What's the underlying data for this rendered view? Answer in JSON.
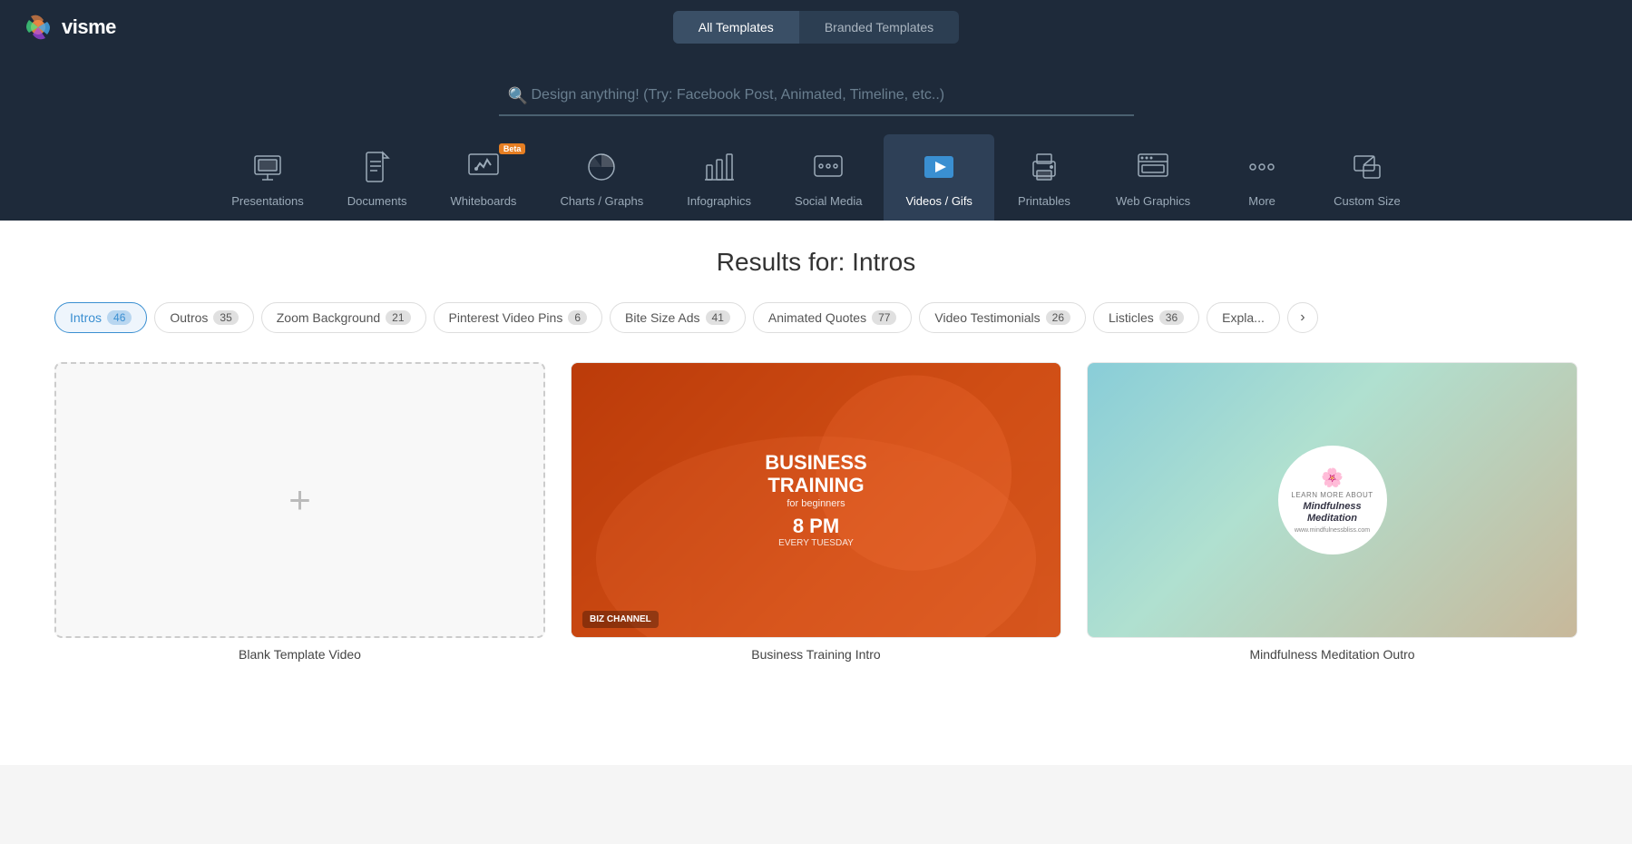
{
  "logo": {
    "text": "visme"
  },
  "header": {
    "toggle": {
      "all_templates": "All Templates",
      "branded_templates": "Branded Templates",
      "active": "all"
    }
  },
  "search": {
    "placeholder": "Design anything! (Try: Facebook Post, Animated, Timeline, etc..)"
  },
  "categories": [
    {
      "id": "presentations",
      "label": "Presentations",
      "icon": "presentation",
      "active": false
    },
    {
      "id": "documents",
      "label": "Documents",
      "icon": "document",
      "active": false
    },
    {
      "id": "whiteboards",
      "label": "Whiteboards",
      "icon": "whiteboard",
      "active": false,
      "beta": true
    },
    {
      "id": "charts-graphs",
      "label": "Charts / Graphs",
      "icon": "chart",
      "active": false
    },
    {
      "id": "infographics",
      "label": "Infographics",
      "icon": "infographic",
      "active": false
    },
    {
      "id": "social-media",
      "label": "Social Media",
      "icon": "social",
      "active": false
    },
    {
      "id": "videos-gifs",
      "label": "Videos / Gifs",
      "icon": "video",
      "active": true
    },
    {
      "id": "printables",
      "label": "Printables",
      "icon": "print",
      "active": false
    },
    {
      "id": "web-graphics",
      "label": "Web Graphics",
      "icon": "web",
      "active": false
    },
    {
      "id": "more",
      "label": "More",
      "icon": "more",
      "active": false
    },
    {
      "id": "custom-size",
      "label": "Custom Size",
      "icon": "custom",
      "active": false
    }
  ],
  "results": {
    "heading": "Results for: Intros"
  },
  "filters": [
    {
      "id": "intros",
      "label": "Intros",
      "count": 46,
      "active": true
    },
    {
      "id": "outros",
      "label": "Outros",
      "count": 35,
      "active": false
    },
    {
      "id": "zoom-background",
      "label": "Zoom Background",
      "count": 21,
      "active": false
    },
    {
      "id": "pinterest-video-pins",
      "label": "Pinterest Video Pins",
      "count": 6,
      "active": false
    },
    {
      "id": "bite-size-ads",
      "label": "Bite Size Ads",
      "count": 41,
      "active": false
    },
    {
      "id": "animated-quotes",
      "label": "Animated Quotes",
      "count": 77,
      "active": false
    },
    {
      "id": "video-testimonials",
      "label": "Video Testimonials",
      "count": 26,
      "active": false
    },
    {
      "id": "listicles",
      "label": "Listicles",
      "count": 36,
      "active": false
    },
    {
      "id": "expla",
      "label": "Expla...",
      "count": null,
      "active": false
    }
  ],
  "templates": [
    {
      "id": "blank",
      "name": "Blank Template Video",
      "type": "blank"
    },
    {
      "id": "business-training",
      "name": "Business Training Intro",
      "type": "business",
      "title_line1": "BUSINESS",
      "title_line2": "TRAINING",
      "subtitle": "for beginners",
      "time_label": "8 PM",
      "time_sub": "EVERY TUESDAY"
    },
    {
      "id": "mindfulness",
      "name": "Mindfulness Meditation Outro",
      "type": "mindfulness",
      "learn_text": "LEARN MORE ABOUT",
      "title": "Mindfulness Meditation",
      "url": "www.mindfulnessbliss.com"
    }
  ],
  "scroll_arrow": "›"
}
